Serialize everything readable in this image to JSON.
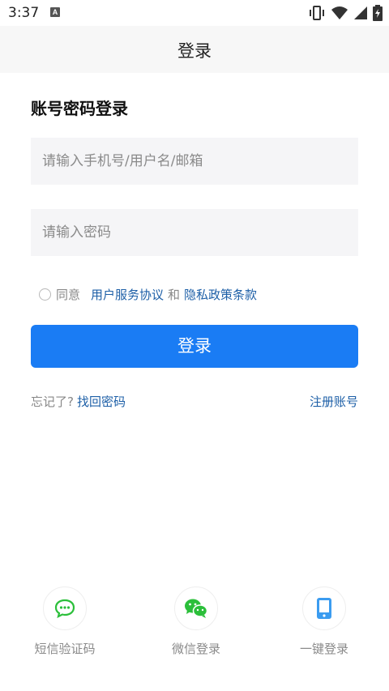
{
  "status_bar": {
    "time": "3:37",
    "notification_letter": "A"
  },
  "header": {
    "title": "登录"
  },
  "form": {
    "section_title": "账号密码登录",
    "account_placeholder": "请输入手机号/用户名/邮箱",
    "password_placeholder": "请输入密码",
    "agree_prefix": "同意",
    "user_agreement": "用户服务协议",
    "and_text": "和",
    "privacy_policy": "隐私政策条款",
    "agree_checked": false,
    "login_label": "登录",
    "forgot_text": "忘记了?",
    "retrieve_password": "找回密码",
    "register": "注册账号"
  },
  "alt_login": [
    {
      "label": "短信验证码",
      "icon": "chat-bubble-icon",
      "color": "#2bbf3a"
    },
    {
      "label": "微信登录",
      "icon": "wechat-icon",
      "color": "#2bbf3a"
    },
    {
      "label": "一键登录",
      "icon": "phone-icon",
      "color": "#3b9cf0"
    }
  ],
  "colors": {
    "primary": "#1a7cf4",
    "link": "#1d5fa7",
    "header_bg": "#f7f7f7",
    "input_bg": "#f5f5f7"
  }
}
